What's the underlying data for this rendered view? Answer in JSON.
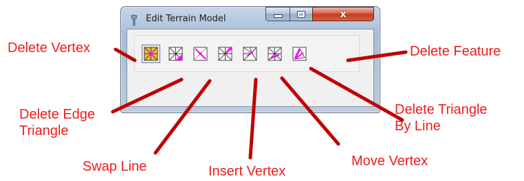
{
  "window": {
    "title": "Edit Terrain Model",
    "minimize_glyph": "minimize-icon",
    "maximize_glyph": "maximize-icon",
    "close_label": "x"
  },
  "tools": [
    {
      "name": "delete-vertex",
      "icon": "delete-vertex-icon",
      "active": true
    },
    {
      "name": "delete-edge-triangle",
      "icon": "delete-edge-triangle-icon",
      "active": false
    },
    {
      "name": "swap-line",
      "icon": "swap-line-icon",
      "active": false
    },
    {
      "name": "insert-vertex",
      "icon": "insert-vertex-icon",
      "active": false
    },
    {
      "name": "move-vertex",
      "icon": "move-vertex-icon",
      "active": false
    },
    {
      "name": "delete-triangle-by-line",
      "icon": "delete-triangle-by-line-icon",
      "active": false
    },
    {
      "name": "delete-feature",
      "icon": "delete-feature-icon",
      "active": false
    }
  ],
  "callouts": {
    "delete_vertex": "Delete Vertex",
    "delete_feature": "Delete Feature",
    "delete_edge_triangle_line1": "Delete Edge",
    "delete_edge_triangle_line2": "Triangle",
    "delete_triangle_by_line_line1": "Delete Triangle",
    "delete_triangle_by_line_line2": "By Line",
    "swap_line": "Swap Line",
    "insert_vertex": "Insert Vertex",
    "move_vertex": "Move Vertex"
  },
  "colors": {
    "callout_text": "#ee1c1c",
    "arrow": "#c00000",
    "icon_accent": "#ff00ff",
    "active_tool_bg": "#fbeac6"
  }
}
